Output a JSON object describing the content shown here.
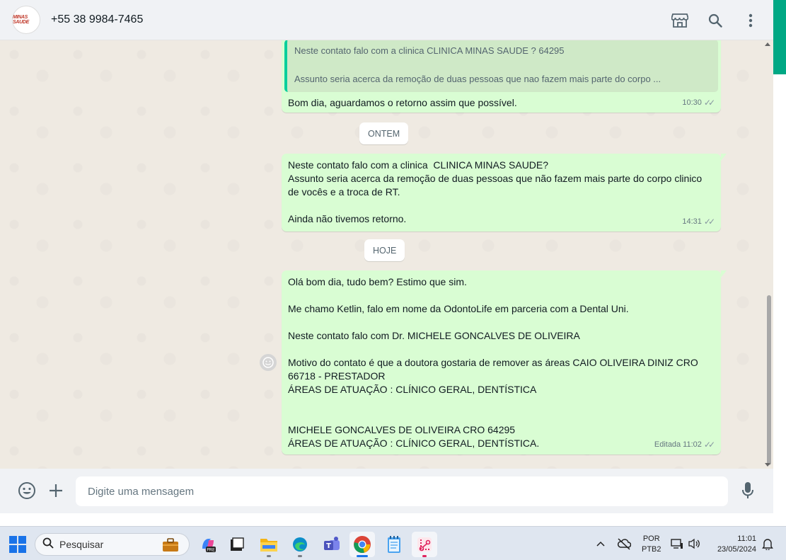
{
  "header": {
    "contact_name": "+55 38 9984-7465",
    "avatar_logo": "MINAS SAUDE",
    "icons": [
      "store-icon",
      "search-icon",
      "more-options-icon"
    ]
  },
  "messages": [
    {
      "quote_line1": "Neste contato falo com a clinica  CLINICA MINAS SAUDE ? 64295",
      "quote_line2": "Assunto seria acerca da remoção de duas pessoas que nao fazem mais parte do corpo ...",
      "text": "Bom dia, aguardamos o retorno assim que possível.",
      "time": "10:30"
    },
    {
      "date_separator": "ONTEM",
      "text": "Neste contato falo com a clinica  CLINICA MINAS SAUDE?\nAssunto seria acerca da remoção de duas pessoas que não fazem mais parte do corpo clinico de vocês e a troca de RT.\n\nAinda não tivemos retorno.",
      "time": "14:31"
    },
    {
      "date_separator": "HOJE",
      "text": "Olá bom dia, tudo bem? Estimo que sim.\n\nMe chamo Ketlin, falo em nome da OdontoLife em parceria com a Dental Uni.\n\nNeste contato falo com Dr. MICHELE GONCALVES DE OLIVEIRA\n\nMotivo do contato é que a doutora gostaria de remover as áreas CAIO OLIVEIRA DINIZ CRO 66718 - PRESTADOR\nÁREAS DE ATUAÇÃO : CLÍNICO GERAL, DENTÍSTICA\n\n\nMICHELE GONCALVES DE OLIVEIRA CRO 64295\nÁREAS DE ATUAÇÃO : CLÍNICO GERAL, DENTÍSTICA.",
      "edited_label": "Editada",
      "time": "11:02"
    }
  ],
  "composer": {
    "placeholder": "Digite uma mensagem"
  },
  "taskbar": {
    "search_label": "Pesquisar",
    "lang_top": "POR",
    "lang_bottom": "PTB2",
    "time": "11:01",
    "date": "23/05/2024"
  },
  "colors": {
    "bubble_out": "#d9fdd3",
    "chat_bg": "#efeae2",
    "accent": "#00a884"
  }
}
